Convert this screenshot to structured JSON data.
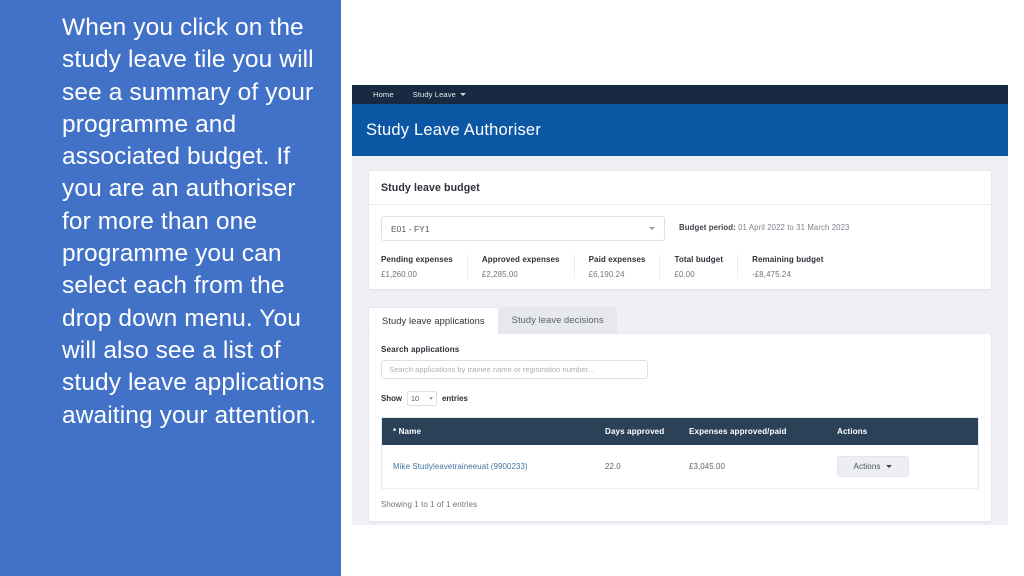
{
  "slide": {
    "body_text": "When you click on the study leave tile you will see a summary of your programme and associated budget. If you are an authoriser for more than one programme you can select each from the drop down menu. You will also see a list of study leave applications awaiting your attention.",
    "background_color": "#4272C8",
    "text_color": "#ffffff"
  },
  "app": {
    "navbar": {
      "background_color": "#172a41",
      "items": [
        {
          "label": "Home",
          "has_caret": false
        },
        {
          "label": "Study Leave",
          "has_caret": true
        }
      ]
    },
    "header": {
      "title": "Study Leave Authoriser",
      "background_color": "#0b57a4"
    },
    "budget_card": {
      "title": "Study leave budget",
      "programme_select": {
        "value": "E01 - FY1"
      },
      "budget_period": {
        "label": "Budget period:",
        "value": "01 April 2022 to 31 March 2023"
      },
      "stats": [
        {
          "label": "Pending expenses",
          "value": "£1,260.00"
        },
        {
          "label": "Approved expenses",
          "value": "£2,285.00"
        },
        {
          "label": "Paid expenses",
          "value": "£6,190.24"
        },
        {
          "label": "Total budget",
          "value": "£0.00"
        },
        {
          "label": "Remaining budget",
          "value": "-£8,475.24"
        }
      ]
    },
    "tabs": [
      {
        "label": "Study leave applications",
        "active": true
      },
      {
        "label": "Study leave decisions",
        "active": false
      }
    ],
    "applications": {
      "search_label": "Search applications",
      "search_value": "",
      "search_placeholder": "Search applications by trainee name or registration number...",
      "show_prefix": "Show",
      "entries_value": "10",
      "entries_suffix": "entries",
      "table": {
        "headers": [
          "* Name",
          "Days approved",
          "Expenses approved/paid",
          "Actions"
        ],
        "header_background": "#2b4158",
        "rows": [
          {
            "name": "Mike Studyleavetraineeuat (9900233)",
            "days_approved": "22.0",
            "expenses": "£3,045.00",
            "action_label": "Actions"
          }
        ]
      },
      "showing_entries": "Showing 1 to 1 of 1 entries"
    }
  }
}
